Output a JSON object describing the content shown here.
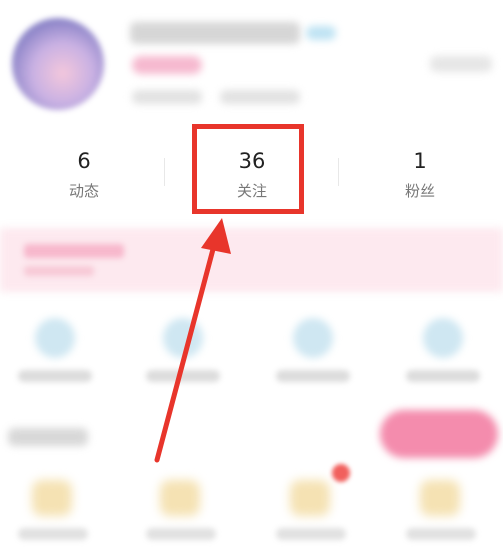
{
  "stats": {
    "items": [
      {
        "value": "6",
        "label": "动态"
      },
      {
        "value": "36",
        "label": "关注"
      },
      {
        "value": "1",
        "label": "粉丝"
      }
    ],
    "highlighted_index": 1
  },
  "colors": {
    "highlight": "#e8352b",
    "banner": "#fde9ef",
    "accent_pink": "#f48cad",
    "text_primary": "#222222",
    "text_secondary": "#777777"
  },
  "annotation": {
    "type": "arrow",
    "points_to": "stat-following"
  }
}
